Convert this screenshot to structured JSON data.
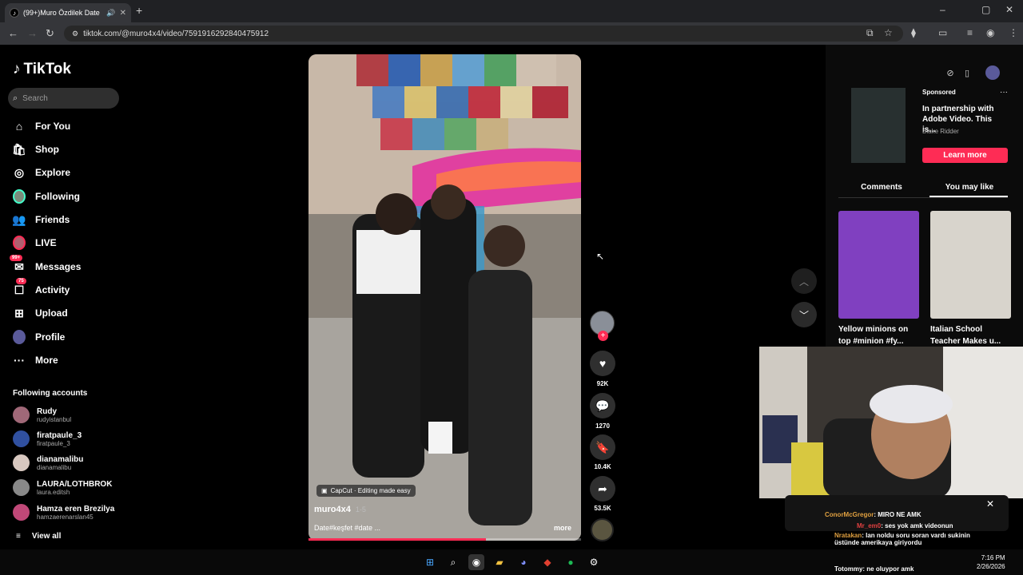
{
  "browser": {
    "tab_title": "(99+)Muro Özdilek Date İd",
    "url": "tiktok.com/@muro4x4/video/7591916292840475912"
  },
  "sidebar": {
    "logo": "TikTok",
    "search_placeholder": "Search",
    "nav": [
      {
        "label": "For You",
        "icon": "home-icon"
      },
      {
        "label": "Shop",
        "icon": "shop-icon"
      },
      {
        "label": "Explore",
        "icon": "compass-icon"
      },
      {
        "label": "Following",
        "icon": "avatar"
      },
      {
        "label": "Friends",
        "icon": "friends-icon"
      },
      {
        "label": "LIVE",
        "icon": "live-avatar"
      },
      {
        "label": "Messages",
        "icon": "messages-icon",
        "badge": "99+"
      },
      {
        "label": "Activity",
        "icon": "activity-icon",
        "badge": "75"
      },
      {
        "label": "Upload",
        "icon": "upload-icon"
      },
      {
        "label": "Profile",
        "icon": "avatar"
      },
      {
        "label": "More",
        "icon": "more-icon"
      }
    ],
    "following_title": "Following accounts",
    "accounts": [
      {
        "name": "Rudy",
        "handle": "rudyistanbul"
      },
      {
        "name": "firatpaule_3",
        "handle": "firatpaule_3"
      },
      {
        "name": "dianamalibu",
        "handle": "dianamalibu"
      },
      {
        "name": "LAURA/LOTHBROK",
        "handle": "laura.editsh"
      },
      {
        "name": "Hamza eren Brezilya",
        "handle": "hamzaerenarslan45"
      }
    ],
    "view_all": "View all"
  },
  "video": {
    "capcut": "CapCut · Editing made easy",
    "author": "muro4x4",
    "duration": "1-5",
    "caption": "Date#keşfet #date ...",
    "more": "more",
    "progress": 0.65,
    "likes": "92K",
    "comments": "1270",
    "saves": "10.4K",
    "shares": "53.5K"
  },
  "ad": {
    "sponsored": "Sponsored",
    "title": "In partnership with Adobe Video. This is...",
    "author": "Blake Ridder",
    "cta": "Learn more"
  },
  "tabs": [
    "Comments",
    "You may like"
  ],
  "suggestions": [
    {
      "title": "Yellow minions on top #minion #fy..."
    },
    {
      "title": "Italian School Teacher Makes u..."
    }
  ],
  "chat": [
    {
      "user": "ConorMcGregor",
      "msg": ": MIRO NE AMK"
    },
    {
      "user": "Mr_em0",
      "msg": ": ses yok amk videonun"
    },
    {
      "user": "Nratakan",
      "msg": ": lan noldu soru soran vardı sukinin"
    },
    {
      "user": "",
      "msg": "üstünde amerikaya giriyordu"
    },
    {
      "user": "Totommy",
      "msg": ": ne oluypor amk"
    }
  ],
  "clock": {
    "time": "7:16 PM",
    "date": "2/26/2026"
  },
  "colors": {
    "accent": "#fe2c55",
    "bg": "#000000"
  }
}
